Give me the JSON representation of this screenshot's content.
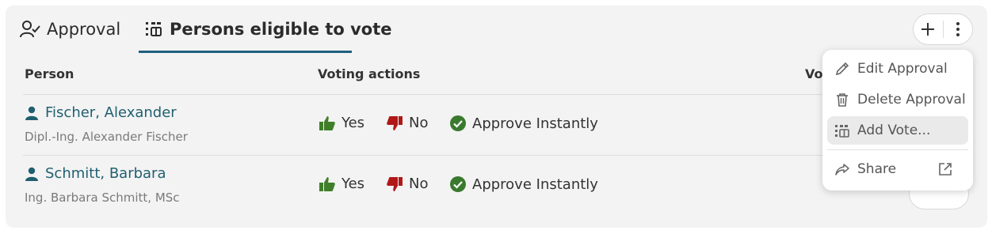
{
  "tabs": {
    "approval_label": "Approval",
    "persons_label": "Persons eligible to vote"
  },
  "table": {
    "headers": {
      "person": "Person",
      "actions": "Voting actions",
      "vote": "Vo"
    },
    "rows": [
      {
        "name": "Fischer, Alexander",
        "subtitle": "Dipl.-Ing. Alexander Fischer",
        "yes": "Yes",
        "no": "No",
        "approve": "Approve Instantly"
      },
      {
        "name": "Schmitt, Barbara",
        "subtitle": "Ing. Barbara Schmitt, MSc",
        "yes": "Yes",
        "no": "No",
        "approve": "Approve Instantly"
      }
    ]
  },
  "menu": {
    "edit": "Edit Approval",
    "delete": "Delete Approval",
    "add_vote": "Add Vote...",
    "share": "Share"
  },
  "colors": {
    "accent": "#1f5f7f",
    "yes_green": "#3f7f2a",
    "no_red": "#b01818",
    "approve_green": "#3a7a2e"
  },
  "icons": [
    "person-check-icon",
    "list-grid-icon",
    "plus-icon",
    "kebab-icon",
    "person-icon",
    "thumbs-up-icon",
    "thumbs-down-icon",
    "check-circle-icon",
    "pencil-icon",
    "trash-icon",
    "share-icon",
    "external-link-icon"
  ]
}
